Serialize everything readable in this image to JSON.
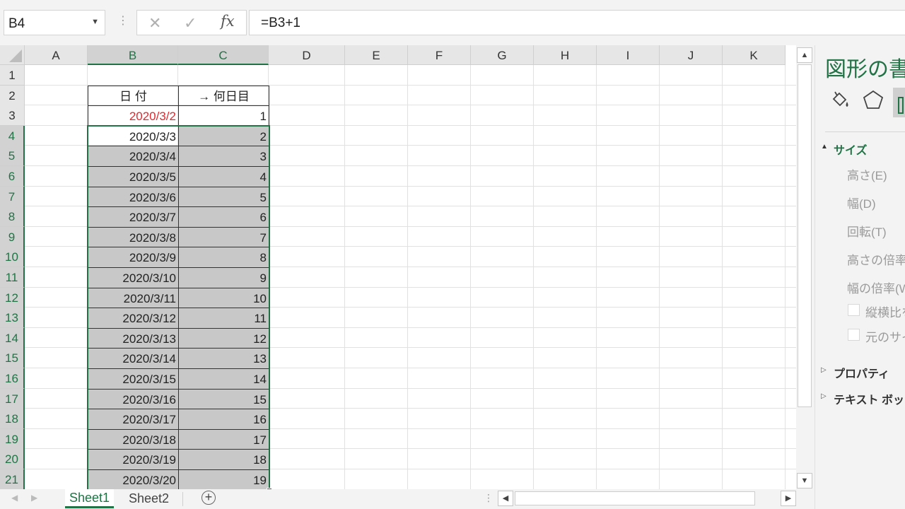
{
  "formula_bar": {
    "name_box": "B4",
    "formula": "=B3+1",
    "fx_label": "fx"
  },
  "columns": [
    "A",
    "B",
    "C",
    "D",
    "E",
    "F",
    "G",
    "H",
    "I",
    "J",
    "K"
  ],
  "selected_columns": [
    "B",
    "C"
  ],
  "rows": [
    "1",
    "2",
    "3",
    "4",
    "5",
    "6",
    "7",
    "8",
    "9",
    "10",
    "11",
    "12",
    "13",
    "14",
    "15",
    "16",
    "17",
    "18",
    "19",
    "20",
    "21"
  ],
  "cells": {
    "B2": "日 付",
    "C2": "→ 何日目",
    "dates": [
      "2020/3/2",
      "2020/3/3",
      "2020/3/4",
      "2020/3/5",
      "2020/3/6",
      "2020/3/7",
      "2020/3/8",
      "2020/3/9",
      "2020/3/10",
      "2020/3/11",
      "2020/3/12",
      "2020/3/13",
      "2020/3/14",
      "2020/3/15",
      "2020/3/16",
      "2020/3/17",
      "2020/3/18",
      "2020/3/19",
      "2020/3/20"
    ],
    "day_numbers": [
      "1",
      "2",
      "3",
      "4",
      "5",
      "6",
      "7",
      "8",
      "9",
      "10",
      "11",
      "12",
      "13",
      "14",
      "15",
      "16",
      "17",
      "18",
      "19"
    ]
  },
  "colors": {
    "accent": "#217346",
    "first_date": "#e0282e",
    "selection_fill": "#c8c8c8"
  },
  "sheets": {
    "tabs": [
      "Sheet1",
      "Sheet2"
    ],
    "active": "Sheet1",
    "add_icon": "plus-circle-icon"
  },
  "side_pane": {
    "title": "図形の書",
    "icons": [
      "paint-bucket-icon",
      "pentagon-icon",
      "size-properties-icon"
    ],
    "size_section": "サイズ",
    "height_label": "高さ(E)",
    "width_label": "幅(D)",
    "rotation_label": "回転(T)",
    "scale_height_label": "高さの倍率(",
    "scale_width_label": "幅の倍率(W",
    "lock_aspect_label": "縦横比を",
    "original_size_label": "元のサイ",
    "properties_section": "プロパティ",
    "textbox_section": "テキスト ボッ"
  }
}
